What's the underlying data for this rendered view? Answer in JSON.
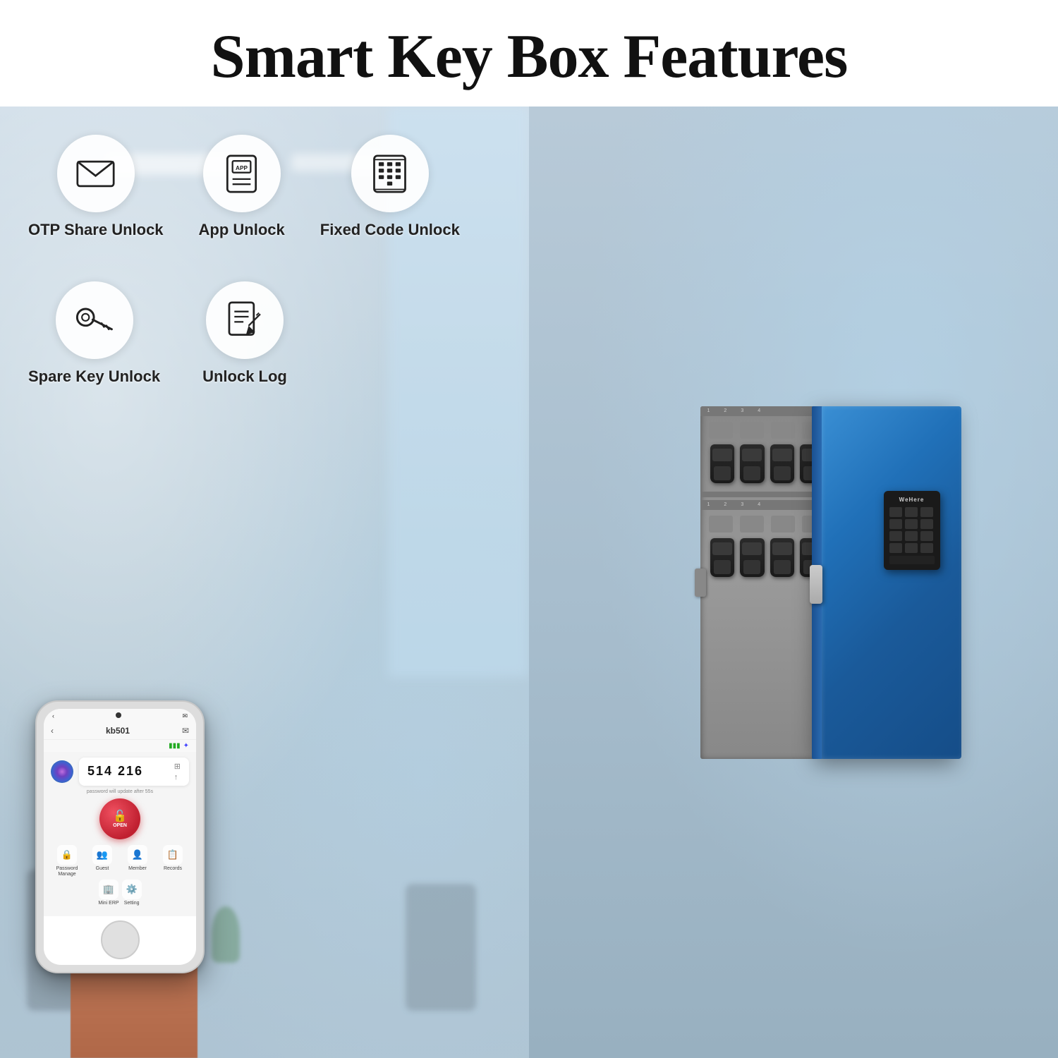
{
  "header": {
    "title": "Smart Key Box Features"
  },
  "features": {
    "row1": [
      {
        "id": "otp-share",
        "label": "OTP Share Unlock",
        "icon": "envelope"
      },
      {
        "id": "app-unlock",
        "label": "App Unlock",
        "icon": "app"
      },
      {
        "id": "fixed-code",
        "label": "Fixed Code Unlock",
        "icon": "keypad"
      }
    ],
    "row2": [
      {
        "id": "spare-key",
        "label": "Spare Key Unlock",
        "icon": "key"
      },
      {
        "id": "unlock-log",
        "label": "Unlock Log",
        "icon": "document"
      }
    ]
  },
  "app": {
    "device_name": "kb501",
    "otp_code": "514 216",
    "timer_text": "password will update after 55s",
    "open_label": "OPEN",
    "menu_items": [
      {
        "id": "password-manage",
        "label": "Password\nManage",
        "icon": "🔒"
      },
      {
        "id": "guest",
        "label": "Guest",
        "icon": "👥"
      },
      {
        "id": "member",
        "label": "Member",
        "icon": "👤"
      },
      {
        "id": "records",
        "label": "Records",
        "icon": "📋"
      }
    ],
    "menu_row2": [
      {
        "id": "mini-erp",
        "label": "Mini ERP",
        "icon": "🏢"
      },
      {
        "id": "setting",
        "label": "Setting",
        "icon": "⚙️"
      }
    ]
  },
  "brand": {
    "name": "WeHere"
  },
  "colors": {
    "accent_blue": "#2070b8",
    "open_red": "#d03040",
    "header_bg": "#ffffff"
  }
}
